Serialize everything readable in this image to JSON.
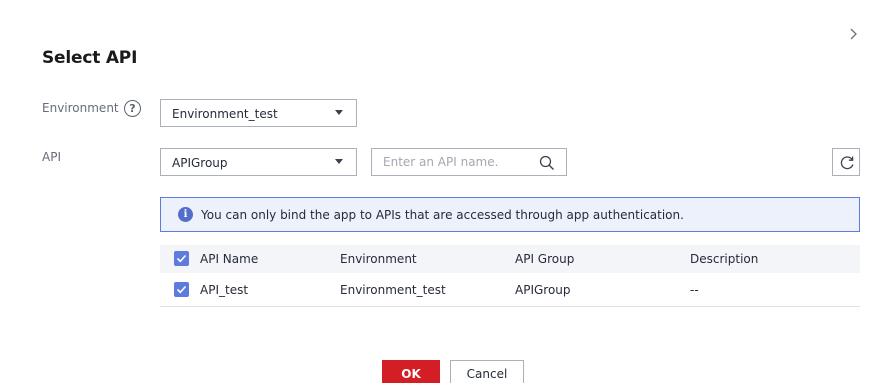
{
  "dialog": {
    "title": "Select API",
    "close_icon": "chevron-right-icon"
  },
  "form": {
    "environment_label": "Environment",
    "help_icon": "question-circle-icon",
    "help_glyph": "?",
    "environment_value": "Environment_test",
    "api_label": "API",
    "api_group_value": "APIGroup",
    "search_placeholder": "Enter an API name.",
    "search_value": "",
    "search_icon": "search-icon",
    "refresh_icon": "refresh-icon"
  },
  "notice": {
    "icon": "info-icon",
    "icon_glyph": "i",
    "text": "You can only bind the app to APIs that are accessed through app authentication."
  },
  "table": {
    "columns": [
      "API Name",
      "Environment",
      "API Group",
      "Description"
    ],
    "header_checked": true,
    "rows": [
      {
        "checked": true,
        "cells": [
          "API_test",
          "Environment_test",
          "APIGroup",
          "--"
        ]
      }
    ]
  },
  "buttons": {
    "ok_label": "OK",
    "cancel_label": "Cancel"
  },
  "colors": {
    "primary": "#5e7ce0",
    "danger": "#d31e26",
    "notice_bg": "#ecf1fc"
  }
}
